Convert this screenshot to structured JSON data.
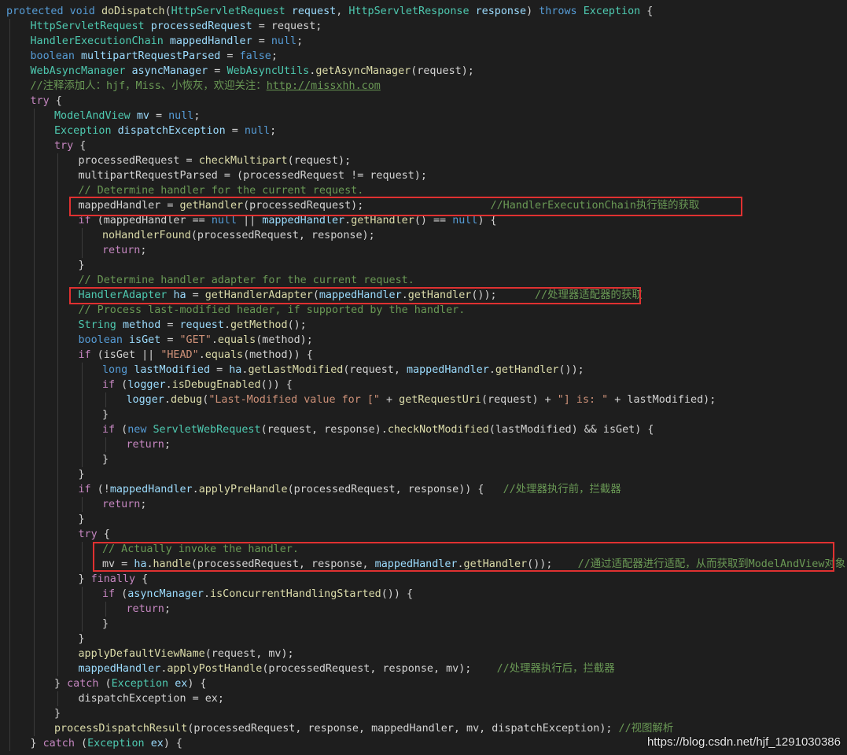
{
  "code_lines": [
    {
      "indent": 0,
      "tokens": [
        [
          "k",
          "protected"
        ],
        [
          "p",
          " "
        ],
        [
          "k",
          "void"
        ],
        [
          "p",
          " "
        ],
        [
          "f",
          "doDispatch"
        ],
        [
          "p",
          "("
        ],
        [
          "t",
          "HttpServletRequest"
        ],
        [
          "p",
          " "
        ],
        [
          "v",
          "request"
        ],
        [
          "p",
          ", "
        ],
        [
          "t",
          "HttpServletResponse"
        ],
        [
          "p",
          " "
        ],
        [
          "v",
          "response"
        ],
        [
          "p",
          ") "
        ],
        [
          "k",
          "throws"
        ],
        [
          "p",
          " "
        ],
        [
          "t",
          "Exception"
        ],
        [
          "p",
          " {"
        ]
      ]
    },
    {
      "indent": 1,
      "tokens": [
        [
          "t",
          "HttpServletRequest"
        ],
        [
          "p",
          " "
        ],
        [
          "v",
          "processedRequest"
        ],
        [
          "p",
          " = request;"
        ]
      ]
    },
    {
      "indent": 1,
      "tokens": [
        [
          "t",
          "HandlerExecutionChain"
        ],
        [
          "p",
          " "
        ],
        [
          "v",
          "mappedHandler"
        ],
        [
          "p",
          " = "
        ],
        [
          "k",
          "null"
        ],
        [
          "p",
          ";"
        ]
      ]
    },
    {
      "indent": 1,
      "tokens": [
        [
          "k",
          "boolean"
        ],
        [
          "p",
          " "
        ],
        [
          "v",
          "multipartRequestParsed"
        ],
        [
          "p",
          " = "
        ],
        [
          "k",
          "false"
        ],
        [
          "p",
          ";"
        ]
      ]
    },
    {
      "indent": 1,
      "tokens": [
        [
          "t",
          "WebAsyncManager"
        ],
        [
          "p",
          " "
        ],
        [
          "v",
          "asyncManager"
        ],
        [
          "p",
          " = "
        ],
        [
          "t",
          "WebAsyncUtils"
        ],
        [
          "p",
          "."
        ],
        [
          "f",
          "getAsyncManager"
        ],
        [
          "p",
          "(request);"
        ]
      ]
    },
    {
      "indent": 1,
      "tokens": [
        [
          "c",
          "//注释添加人：hjf，Miss、小恢灰，欢迎关注："
        ],
        [
          "u",
          "http://missxhh.com"
        ]
      ]
    },
    {
      "indent": 1,
      "tokens": [
        [
          "cf",
          "try"
        ],
        [
          "p",
          " {"
        ]
      ]
    },
    {
      "indent": 2,
      "tokens": [
        [
          "t",
          "ModelAndView"
        ],
        [
          "p",
          " "
        ],
        [
          "v",
          "mv"
        ],
        [
          "p",
          " = "
        ],
        [
          "k",
          "null"
        ],
        [
          "p",
          ";"
        ]
      ]
    },
    {
      "indent": 2,
      "tokens": [
        [
          "t",
          "Exception"
        ],
        [
          "p",
          " "
        ],
        [
          "v",
          "dispatchException"
        ],
        [
          "p",
          " = "
        ],
        [
          "k",
          "null"
        ],
        [
          "p",
          ";"
        ]
      ]
    },
    {
      "indent": 2,
      "tokens": [
        [
          "cf",
          "try"
        ],
        [
          "p",
          " {"
        ]
      ]
    },
    {
      "indent": 3,
      "tokens": [
        [
          "p",
          "processedRequest = "
        ],
        [
          "f",
          "checkMultipart"
        ],
        [
          "p",
          "(request);"
        ]
      ]
    },
    {
      "indent": 3,
      "tokens": [
        [
          "p",
          "multipartRequestParsed = (processedRequest != request);"
        ]
      ]
    },
    {
      "indent": 3,
      "tokens": [
        [
          "c",
          "// Determine handler for the current request."
        ]
      ]
    },
    {
      "indent": 3,
      "tokens": [
        [
          "p",
          "mappedHandler = "
        ],
        [
          "f",
          "getHandler"
        ],
        [
          "p",
          "(processedRequest);                    "
        ],
        [
          "c",
          "//HandlerExecutionChain执行链的获取"
        ]
      ]
    },
    {
      "indent": 3,
      "tokens": [
        [
          "cf",
          "if"
        ],
        [
          "p",
          " (mappedHandler == "
        ],
        [
          "k",
          "null"
        ],
        [
          "p",
          " || "
        ],
        [
          "v",
          "mappedHandler"
        ],
        [
          "p",
          "."
        ],
        [
          "f",
          "getHandler"
        ],
        [
          "p",
          "() == "
        ],
        [
          "k",
          "null"
        ],
        [
          "p",
          ") {"
        ]
      ]
    },
    {
      "indent": 4,
      "tokens": [
        [
          "f",
          "noHandlerFound"
        ],
        [
          "p",
          "(processedRequest, response);"
        ]
      ]
    },
    {
      "indent": 4,
      "tokens": [
        [
          "cf",
          "return"
        ],
        [
          "p",
          ";"
        ]
      ]
    },
    {
      "indent": 3,
      "tokens": [
        [
          "p",
          "}"
        ]
      ]
    },
    {
      "indent": 3,
      "tokens": [
        [
          "c",
          "// Determine handler adapter for the current request."
        ]
      ]
    },
    {
      "indent": 3,
      "tokens": [
        [
          "t",
          "HandlerAdapter"
        ],
        [
          "p",
          " "
        ],
        [
          "v",
          "ha"
        ],
        [
          "p",
          " = "
        ],
        [
          "f",
          "getHandlerAdapter"
        ],
        [
          "p",
          "("
        ],
        [
          "v",
          "mappedHandler"
        ],
        [
          "p",
          "."
        ],
        [
          "f",
          "getHandler"
        ],
        [
          "p",
          "());      "
        ],
        [
          "c",
          "//处理器适配器的获取"
        ]
      ]
    },
    {
      "indent": 3,
      "tokens": [
        [
          "c",
          "// Process last-modified header, if supported by the handler."
        ]
      ]
    },
    {
      "indent": 3,
      "tokens": [
        [
          "t",
          "String"
        ],
        [
          "p",
          " "
        ],
        [
          "v",
          "method"
        ],
        [
          "p",
          " = "
        ],
        [
          "v",
          "request"
        ],
        [
          "p",
          "."
        ],
        [
          "f",
          "getMethod"
        ],
        [
          "p",
          "();"
        ]
      ]
    },
    {
      "indent": 3,
      "tokens": [
        [
          "k",
          "boolean"
        ],
        [
          "p",
          " "
        ],
        [
          "v",
          "isGet"
        ],
        [
          "p",
          " = "
        ],
        [
          "s",
          "\"GET\""
        ],
        [
          "p",
          "."
        ],
        [
          "f",
          "equals"
        ],
        [
          "p",
          "(method);"
        ]
      ]
    },
    {
      "indent": 3,
      "tokens": [
        [
          "cf",
          "if"
        ],
        [
          "p",
          " (isGet || "
        ],
        [
          "s",
          "\"HEAD\""
        ],
        [
          "p",
          "."
        ],
        [
          "f",
          "equals"
        ],
        [
          "p",
          "(method)) {"
        ]
      ]
    },
    {
      "indent": 4,
      "tokens": [
        [
          "k",
          "long"
        ],
        [
          "p",
          " "
        ],
        [
          "v",
          "lastModified"
        ],
        [
          "p",
          " = "
        ],
        [
          "v",
          "ha"
        ],
        [
          "p",
          "."
        ],
        [
          "f",
          "getLastModified"
        ],
        [
          "p",
          "(request, "
        ],
        [
          "v",
          "mappedHandler"
        ],
        [
          "p",
          "."
        ],
        [
          "f",
          "getHandler"
        ],
        [
          "p",
          "());"
        ]
      ]
    },
    {
      "indent": 4,
      "tokens": [
        [
          "cf",
          "if"
        ],
        [
          "p",
          " ("
        ],
        [
          "v",
          "logger"
        ],
        [
          "p",
          "."
        ],
        [
          "f",
          "isDebugEnabled"
        ],
        [
          "p",
          "()) {"
        ]
      ]
    },
    {
      "indent": 5,
      "tokens": [
        [
          "v",
          "logger"
        ],
        [
          "p",
          "."
        ],
        [
          "f",
          "debug"
        ],
        [
          "p",
          "("
        ],
        [
          "s",
          "\"Last-Modified value for [\""
        ],
        [
          "p",
          " + "
        ],
        [
          "f",
          "getRequestUri"
        ],
        [
          "p",
          "(request) + "
        ],
        [
          "s",
          "\"] is: \""
        ],
        [
          "p",
          " + lastModified);"
        ]
      ]
    },
    {
      "indent": 4,
      "tokens": [
        [
          "p",
          "}"
        ]
      ]
    },
    {
      "indent": 4,
      "tokens": [
        [
          "cf",
          "if"
        ],
        [
          "p",
          " ("
        ],
        [
          "k",
          "new"
        ],
        [
          "p",
          " "
        ],
        [
          "t",
          "ServletWebRequest"
        ],
        [
          "p",
          "(request, response)."
        ],
        [
          "f",
          "checkNotModified"
        ],
        [
          "p",
          "(lastModified) && isGet) {"
        ]
      ]
    },
    {
      "indent": 5,
      "tokens": [
        [
          "cf",
          "return"
        ],
        [
          "p",
          ";"
        ]
      ]
    },
    {
      "indent": 4,
      "tokens": [
        [
          "p",
          "}"
        ]
      ]
    },
    {
      "indent": 3,
      "tokens": [
        [
          "p",
          "}"
        ]
      ]
    },
    {
      "indent": 3,
      "tokens": [
        [
          "cf",
          "if"
        ],
        [
          "p",
          " (!"
        ],
        [
          "v",
          "mappedHandler"
        ],
        [
          "p",
          "."
        ],
        [
          "f",
          "applyPreHandle"
        ],
        [
          "p",
          "(processedRequest, response)) {   "
        ],
        [
          "c",
          "//处理器执行前，拦截器"
        ]
      ]
    },
    {
      "indent": 4,
      "tokens": [
        [
          "cf",
          "return"
        ],
        [
          "p",
          ";"
        ]
      ]
    },
    {
      "indent": 3,
      "tokens": [
        [
          "p",
          "}"
        ]
      ]
    },
    {
      "indent": 3,
      "tokens": [
        [
          "cf",
          "try"
        ],
        [
          "p",
          " {"
        ]
      ]
    },
    {
      "indent": 4,
      "tokens": [
        [
          "c",
          "// Actually invoke the handler."
        ]
      ]
    },
    {
      "indent": 4,
      "tokens": [
        [
          "p",
          "mv = "
        ],
        [
          "v",
          "ha"
        ],
        [
          "p",
          "."
        ],
        [
          "f",
          "handle"
        ],
        [
          "p",
          "(processedRequest, response, "
        ],
        [
          "v",
          "mappedHandler"
        ],
        [
          "p",
          "."
        ],
        [
          "f",
          "getHandler"
        ],
        [
          "p",
          "());    "
        ],
        [
          "c",
          "//通过适配器进行适配，从而获取到ModelAndView对象"
        ]
      ]
    },
    {
      "indent": 3,
      "tokens": [
        [
          "p",
          "} "
        ],
        [
          "cf",
          "finally"
        ],
        [
          "p",
          " {"
        ]
      ]
    },
    {
      "indent": 4,
      "tokens": [
        [
          "cf",
          "if"
        ],
        [
          "p",
          " ("
        ],
        [
          "v",
          "asyncManager"
        ],
        [
          "p",
          "."
        ],
        [
          "f",
          "isConcurrentHandlingStarted"
        ],
        [
          "p",
          "()) {"
        ]
      ]
    },
    {
      "indent": 5,
      "tokens": [
        [
          "cf",
          "return"
        ],
        [
          "p",
          ";"
        ]
      ]
    },
    {
      "indent": 4,
      "tokens": [
        [
          "p",
          "}"
        ]
      ]
    },
    {
      "indent": 3,
      "tokens": [
        [
          "p",
          "}"
        ]
      ]
    },
    {
      "indent": 3,
      "tokens": [
        [
          "f",
          "applyDefaultViewName"
        ],
        [
          "p",
          "(request, mv);"
        ]
      ]
    },
    {
      "indent": 3,
      "tokens": [
        [
          "v",
          "mappedHandler"
        ],
        [
          "p",
          "."
        ],
        [
          "f",
          "applyPostHandle"
        ],
        [
          "p",
          "(processedRequest, response, mv);    "
        ],
        [
          "c",
          "//处理器执行后，拦截器"
        ]
      ]
    },
    {
      "indent": 2,
      "tokens": [
        [
          "p",
          "} "
        ],
        [
          "cf",
          "catch"
        ],
        [
          "p",
          " ("
        ],
        [
          "t",
          "Exception"
        ],
        [
          "p",
          " "
        ],
        [
          "v",
          "ex"
        ],
        [
          "p",
          ") {"
        ]
      ]
    },
    {
      "indent": 3,
      "tokens": [
        [
          "p",
          "dispatchException = ex;"
        ]
      ]
    },
    {
      "indent": 2,
      "tokens": [
        [
          "p",
          "}"
        ]
      ]
    },
    {
      "indent": 2,
      "tokens": [
        [
          "f",
          "processDispatchResult"
        ],
        [
          "p",
          "(processedRequest, response, mappedHandler, mv, dispatchException); "
        ],
        [
          "c",
          "//视图解析"
        ]
      ]
    },
    {
      "indent": 1,
      "tokens": [
        [
          "p",
          "} "
        ],
        [
          "cf",
          "catch"
        ],
        [
          "p",
          " ("
        ],
        [
          "t",
          "Exception"
        ],
        [
          "p",
          " "
        ],
        [
          "v",
          "ex"
        ],
        [
          "p",
          ") {"
        ]
      ]
    }
  ],
  "highlighted_lines": [
    13,
    19,
    36,
    37
  ],
  "colors": {
    "background": "#1e1e1e",
    "highlight_border": "#e03131"
  },
  "watermark": "https://blog.csdn.net/hjf_1291030386"
}
